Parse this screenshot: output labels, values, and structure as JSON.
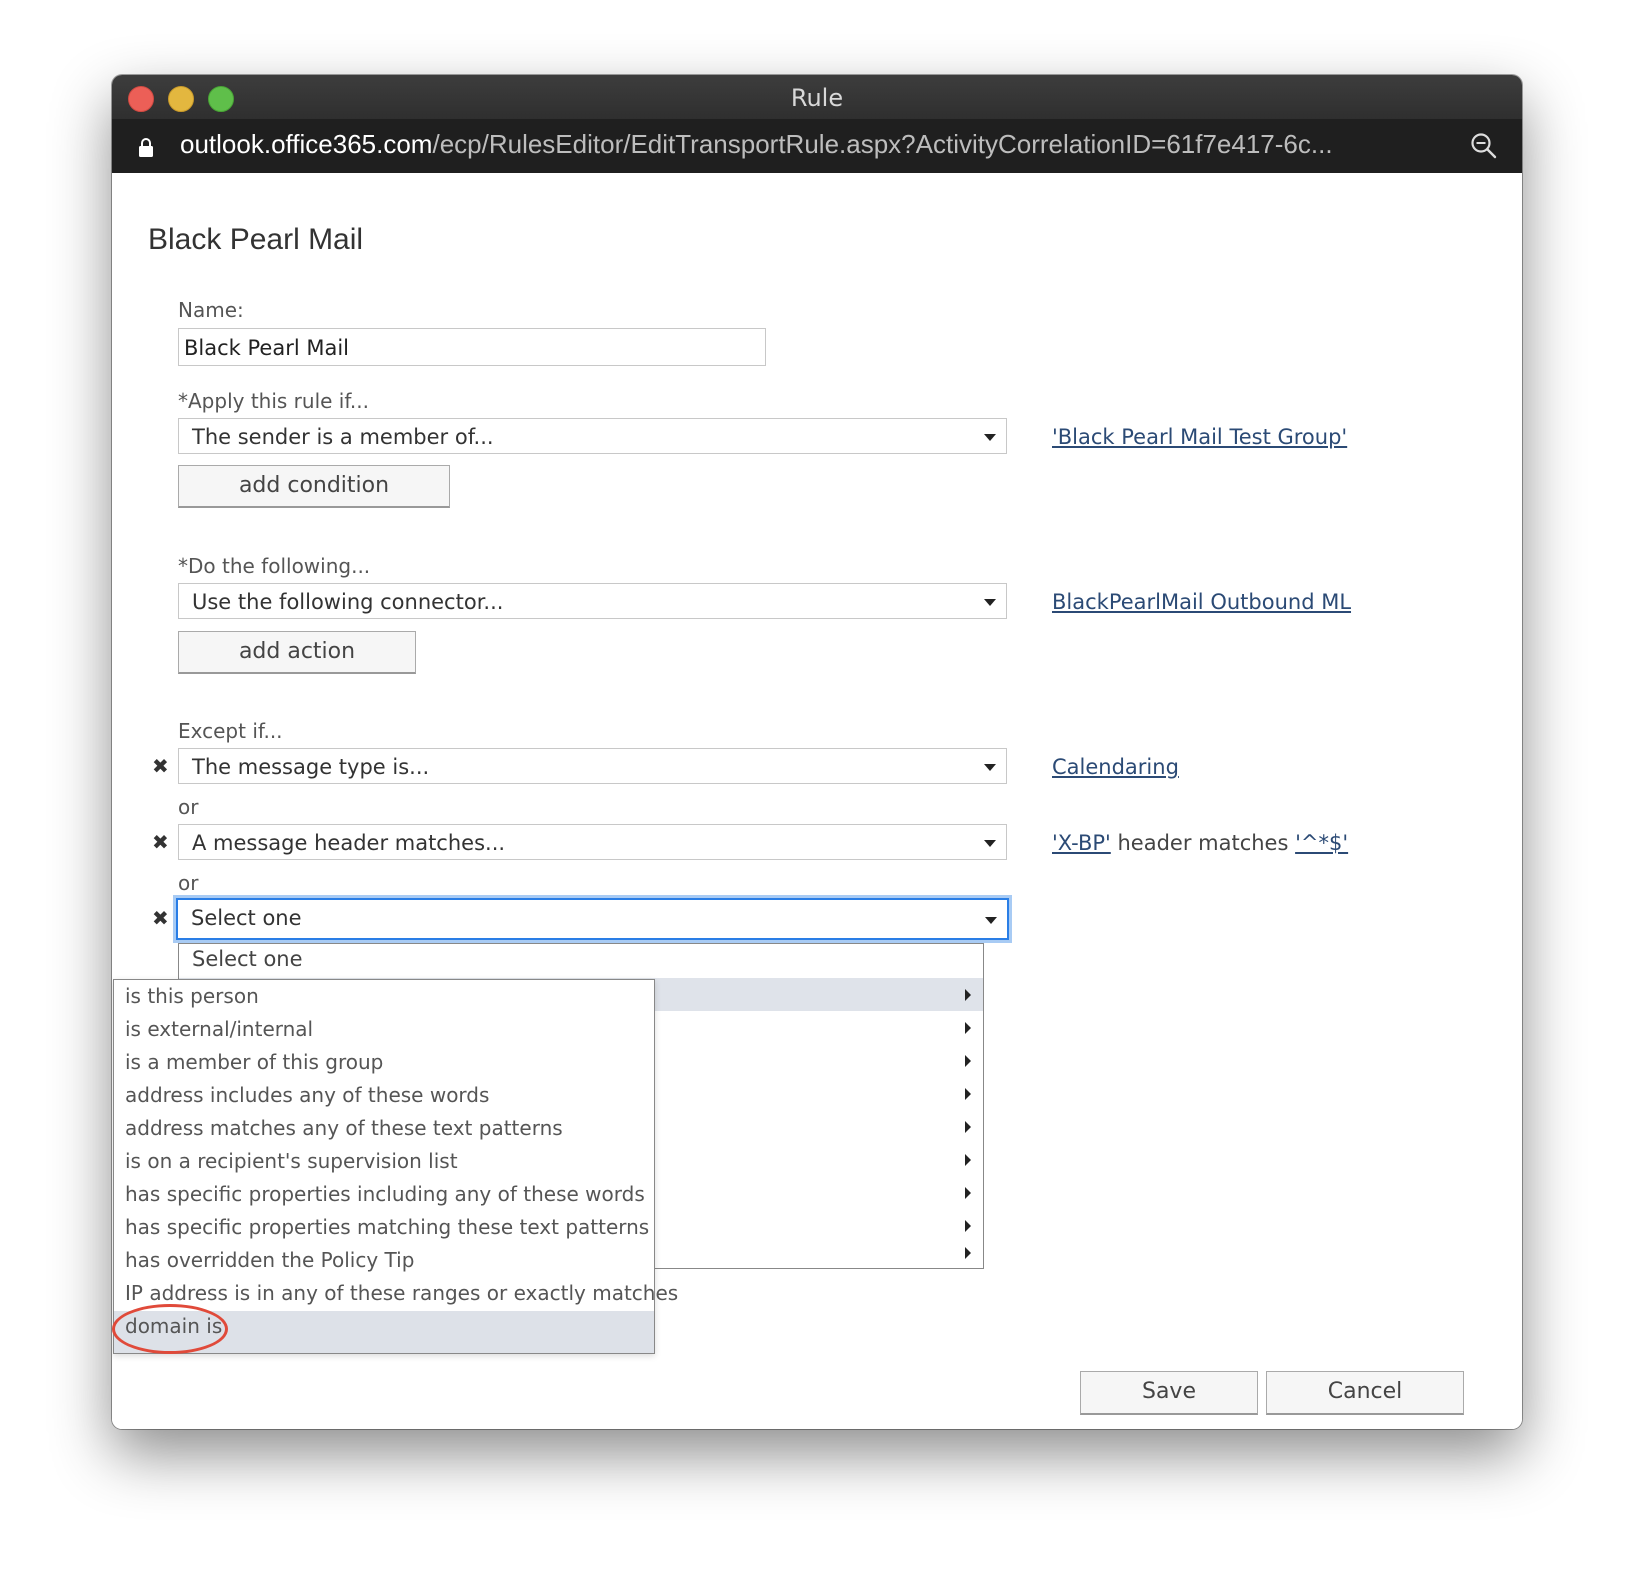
{
  "window": {
    "title": "Rule",
    "url_host": "outlook.office365.com",
    "url_path": "/ecp/RulesEditor/EditTransportRule.aspx?ActivityCorrelationID=61f7e417-6c..."
  },
  "page": {
    "title": "Black Pearl Mail"
  },
  "name": {
    "label": "Name:",
    "value": "Black Pearl Mail"
  },
  "apply": {
    "label": "*Apply this rule if...",
    "selected": "The sender is a member of...",
    "link": "'Black Pearl Mail Test Group'",
    "add_button": "add condition"
  },
  "do": {
    "label": "*Do the following...",
    "selected": "Use the following connector...",
    "link": "BlackPearlMail Outbound ML",
    "add_button": "add action"
  },
  "except": {
    "label": "Except if...",
    "or_label": "or",
    "rows": [
      {
        "selected": "The message type is...",
        "link": "Calendaring"
      },
      {
        "selected": "A message header matches...",
        "link_a": "'X-BP'",
        "middle": " header matches ",
        "link_b": "'^*$'"
      },
      {
        "selected": "Select one"
      }
    ]
  },
  "dropdown": {
    "first_option": "Select one"
  },
  "submenu": {
    "items": [
      "is this person",
      "is external/internal",
      "is a member of this group",
      "address includes any of these words",
      "address matches any of these text patterns",
      "is on a recipient's supervision list",
      "has specific properties including any of these words",
      "has specific properties matching these text patterns",
      "has overridden the Policy Tip",
      "IP address is in any of these ranges or exactly matches",
      "domain is"
    ],
    "highlighted_index": 10
  },
  "buttons": {
    "save": "Save",
    "cancel": "Cancel"
  },
  "colors": {
    "link": "#2b4a75",
    "focus": "#2a7ee6",
    "annotation": "#e04a3a"
  }
}
